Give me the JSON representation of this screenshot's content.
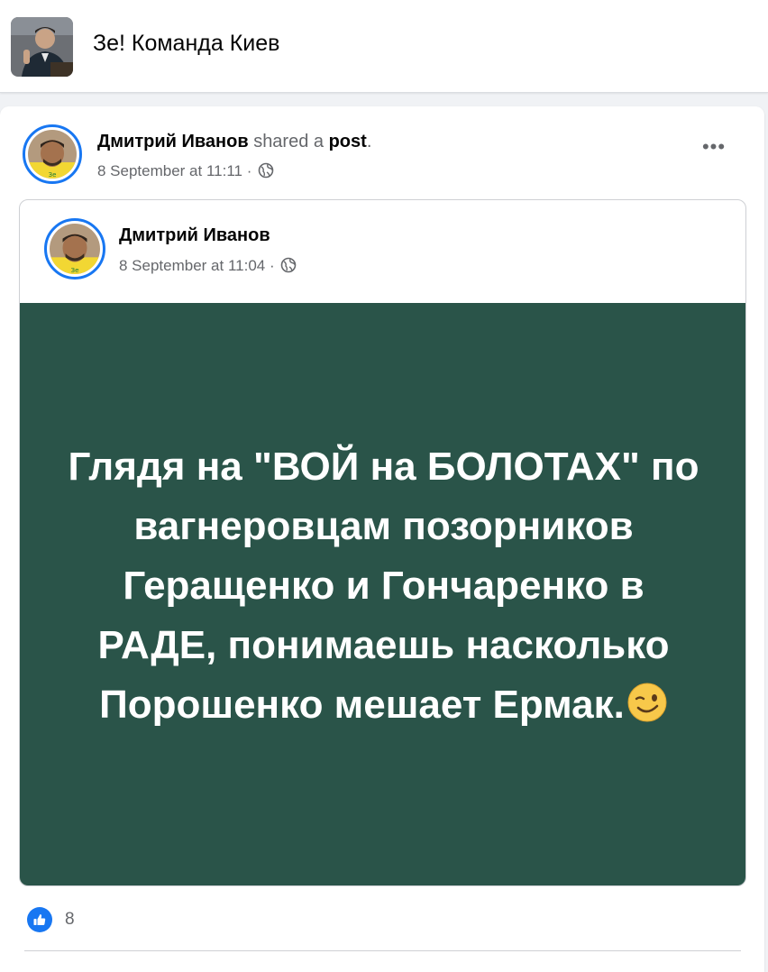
{
  "group": {
    "avatar_icon": "group-avatar-photo",
    "title": "Зе! Команда Киев"
  },
  "share": {
    "author": "Дмитрий Иванов",
    "action_text": "shared a",
    "object_text": "post",
    "period": ".",
    "timestamp": "8 September at 11:11",
    "separator": "·",
    "privacy_icon": "globe-icon",
    "more_icon": "more-options-icon",
    "more_text": "•••"
  },
  "original_post": {
    "author": "Дмитрий Иванов",
    "timestamp": "8 September at 11:04",
    "separator": "·",
    "privacy_icon": "globe-icon",
    "text": "Глядя на \"ВОЙ на БОЛОТАХ\" по вагнеровцам позорников Геращенко и Гончаренко в РАДЕ, понимаешь насколько Порошенко мешает Ермак.",
    "text_emoji": "winking-face-emoji",
    "background_color": "#2a5449"
  },
  "reactions": {
    "icon": "like-icon",
    "count": "8"
  },
  "colors": {
    "accent": "#1877f2",
    "post_background": "#2a5449"
  }
}
